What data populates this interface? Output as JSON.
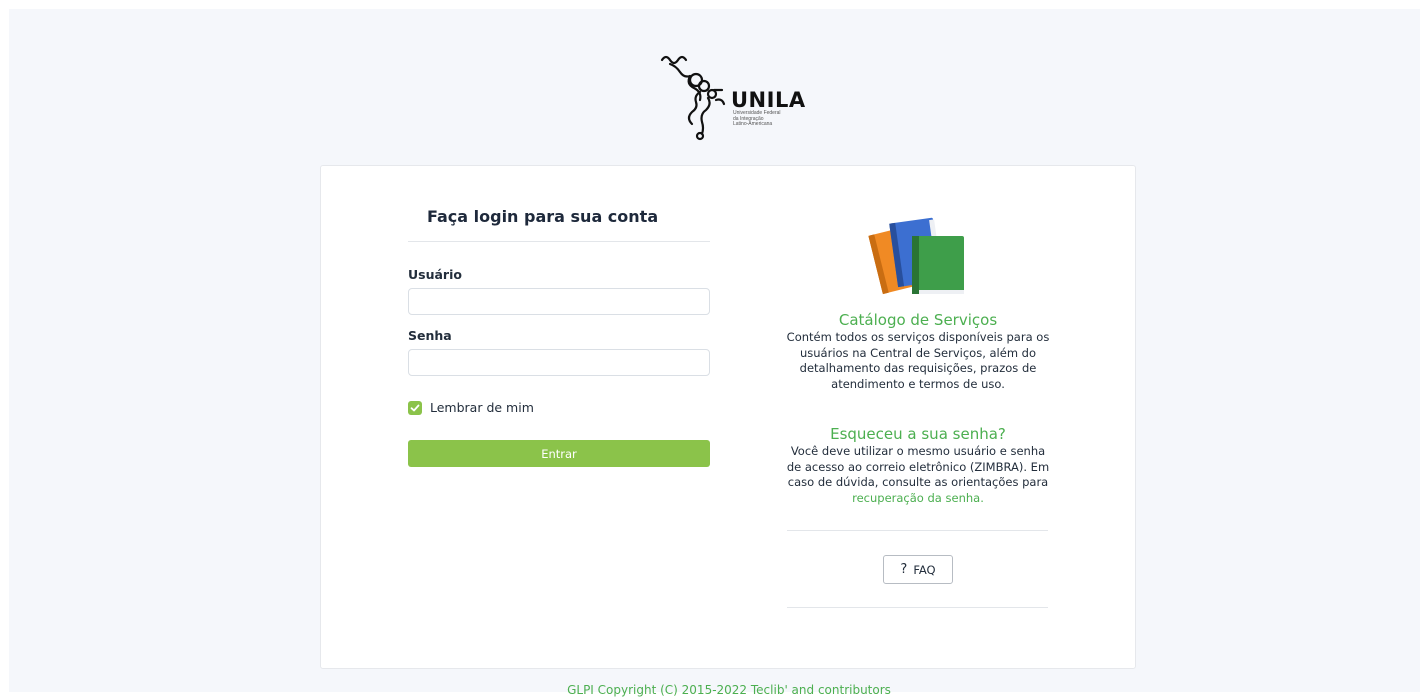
{
  "logo": {
    "wordmark": "UNILA",
    "subtitle_lines": [
      "Universidade Federal",
      "da Integração",
      "Latino-Americana"
    ]
  },
  "login": {
    "title": "Faça login para sua conta",
    "username_label": "Usuário",
    "username_value": "",
    "password_label": "Senha",
    "password_value": "",
    "remember_label": "Lembrar de mim",
    "remember_checked": true,
    "submit_label": "Entrar"
  },
  "catalog": {
    "icon": "books-icon",
    "heading": "Catálogo de Serviços",
    "text": "Contém todos os serviços disponíveis para os usuários na Central de Serviços, além do detalhamento das requisições, prazos de atendimento e termos de uso."
  },
  "forgot": {
    "heading": "Esqueceu a sua senha?",
    "text": "Você deve utilizar o mesmo usuário e senha de acesso ao correio eletrônico (ZIMBRA). Em caso de dúvida, consulte as orientações para",
    "link_text": "recuperação da senha."
  },
  "faq": {
    "icon": "question-mark-icon",
    "label": "FAQ"
  },
  "footer": {
    "text": "GLPI Copyright (C) 2015-2022 Teclib' and contributors"
  },
  "colors": {
    "accent": "#8bc34a",
    "link": "#4caf50",
    "page_bg": "#f5f7fb"
  }
}
